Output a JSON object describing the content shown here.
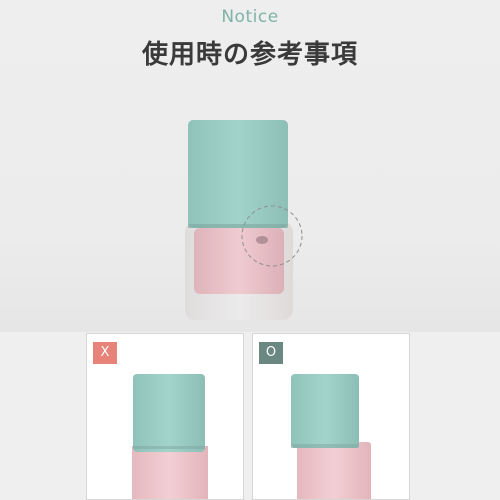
{
  "header": {
    "eyebrow": "Notice",
    "title": "使用時の参考事項"
  },
  "hero": {
    "image": "nail-polish-bottle-cap-gap-illustration",
    "cap_color": "#9ccfc6",
    "body_color": "#e9c3c8",
    "highlight": "dashed-circle-callout"
  },
  "examples": [
    {
      "badge": "X",
      "badge_color": "#e8837a",
      "meaning": "incorrect"
    },
    {
      "badge": "O",
      "badge_color": "#6b8782",
      "meaning": "correct"
    }
  ]
}
